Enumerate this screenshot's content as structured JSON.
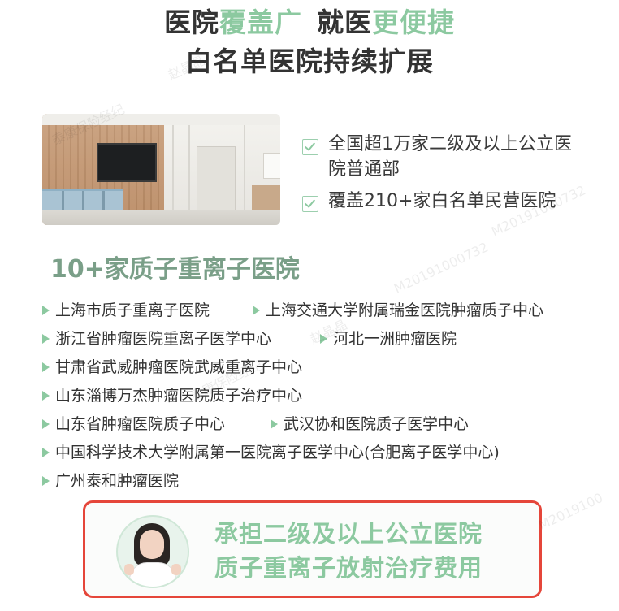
{
  "headline": {
    "line1_part1": "医院",
    "line1_hl1": "覆盖广",
    "line1_part2": "就医",
    "line1_hl2": "更便捷",
    "line2": "白名单医院持续扩展"
  },
  "checks": [
    "全国超1万家二级及以上公立医院普通部",
    "覆盖210+家白名单民营医院"
  ],
  "section_title": "10+家质子重离子医院",
  "hospitals": [
    "上海市质子重离子医院",
    "上海交通大学附属瑞金医院肿瘤质子中心",
    "浙江省肿瘤医院重离子医学中心",
    "河北一洲肿瘤医院",
    "甘肃省武威肿瘤医院武威重离子中心",
    "山东淄博万杰肿瘤医院质子治疗中心",
    "山东省肿瘤医院质子中心",
    "武汉协和医院质子医学中心",
    "中国科学技术大学附属第一医院离子医学中心(合肥离子医学中心)",
    "广州泰和肿瘤医院"
  ],
  "banner": {
    "line1": "承担二级及以上公立医院",
    "line2": "质子重离子放射治疗费用"
  },
  "watermarks": [
    "赵晶晶",
    "M20191000732",
    "泰康保险经纪",
    "M2019100"
  ],
  "colors": {
    "accent_green": "#8cc9a0",
    "section_green": "#7a9f88",
    "banner_border": "#e5463a"
  }
}
